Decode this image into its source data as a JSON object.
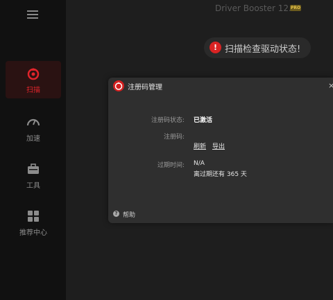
{
  "sidebar": {
    "items": [
      {
        "label": "扫描",
        "icon": "scan-icon",
        "active": true
      },
      {
        "label": "加速",
        "icon": "speedometer-icon",
        "active": false
      },
      {
        "label": "工具",
        "icon": "toolbox-icon",
        "active": false
      },
      {
        "label": "推荐中心",
        "icon": "apps-grid-icon",
        "active": false
      }
    ]
  },
  "header": {
    "app_title": "Driver Booster 12.4",
    "badge": "PRO",
    "scan_prompt": "扫描检查驱动状态!"
  },
  "dialog": {
    "title": "注册码管理",
    "status_label": "注册码状态:",
    "status_value": "已激活",
    "code_label": "注册码:",
    "refresh_link": "刷新",
    "export_link": "导出",
    "expiry_label": "过期时间:",
    "expiry_value": "N/A",
    "days_remaining": "离过期还有 365 天",
    "help_label": "帮助"
  },
  "colors": {
    "accent": "#e0242b",
    "sidebar_bg": "#111111",
    "dialog_bg": "#2f2f2f"
  }
}
